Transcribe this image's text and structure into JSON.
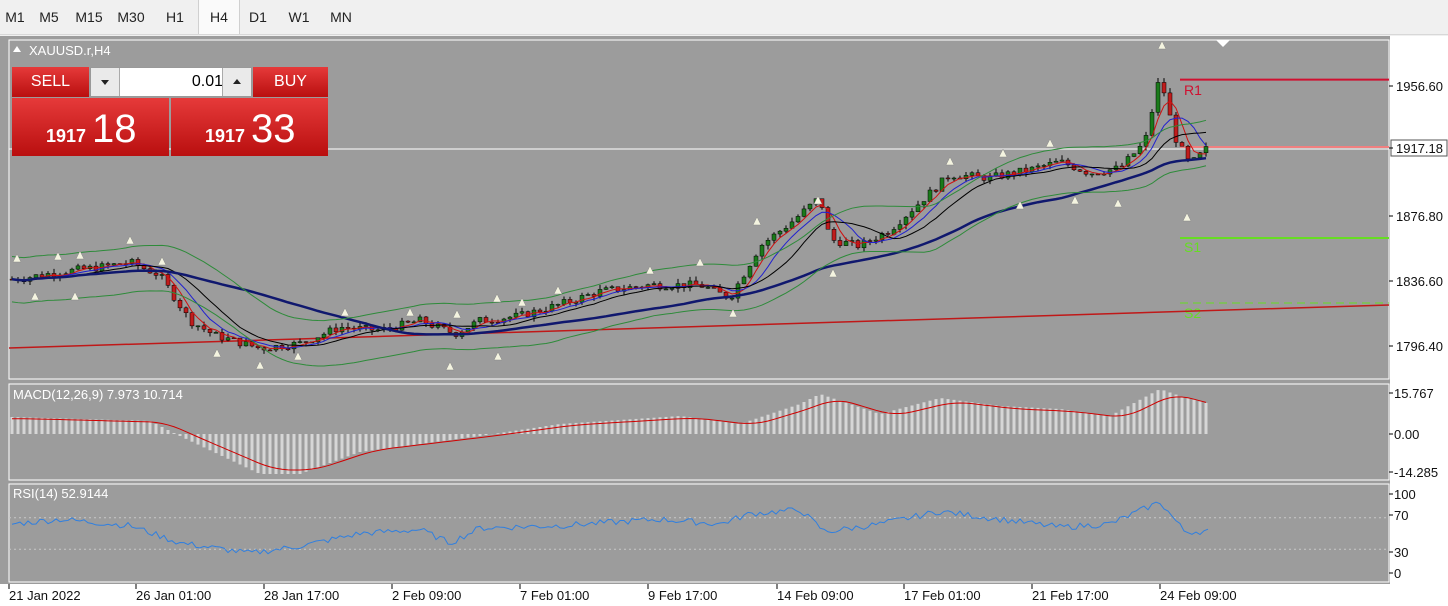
{
  "timeframes": [
    "M1",
    "M5",
    "M15",
    "M30",
    "H1",
    "H4",
    "D1",
    "W1",
    "MN"
  ],
  "active_timeframe": "H4",
  "symbol_label": "XAUUSD.r,H4",
  "trade": {
    "sell_label": "SELL",
    "buy_label": "BUY",
    "lot": "0.01",
    "sell_big": "1917",
    "sell_small": "18",
    "buy_big": "1917",
    "buy_small": "33"
  },
  "price_axis": {
    "ticks": [
      "1956.60",
      "1917.18",
      "1876.80",
      "1836.60",
      "1796.40"
    ],
    "current": "1917.18"
  },
  "pivot_labels": {
    "r1": "R1",
    "s1": "S1",
    "s2": "S2"
  },
  "macd": {
    "title": "MACD(12,26,9) 7.973 10.714",
    "ticks": [
      "15.767",
      "0.00",
      "-14.285"
    ]
  },
  "rsi": {
    "title": "RSI(14) 52.9144",
    "ticks": [
      "100",
      "70",
      "30",
      "0"
    ]
  },
  "time_axis": [
    "21 Jan 2022",
    "26 Jan 01:00",
    "28 Jan 17:00",
    "2 Feb 09:00",
    "7 Feb 01:00",
    "9 Feb 17:00",
    "14 Feb 09:00",
    "17 Feb 01:00",
    "21 Feb 17:00",
    "24 Feb 09:00"
  ],
  "colors": {
    "chart_bg": "#9c9c9c",
    "bull": "#1a7a1a",
    "bear": "#c01c1c",
    "ma_slow": "#10186e",
    "macd_signal": "#d00000",
    "rsi_line": "#2f7fe0",
    "pivot_r1": "#d01030",
    "pivot_s1": "#66dd22"
  }
}
